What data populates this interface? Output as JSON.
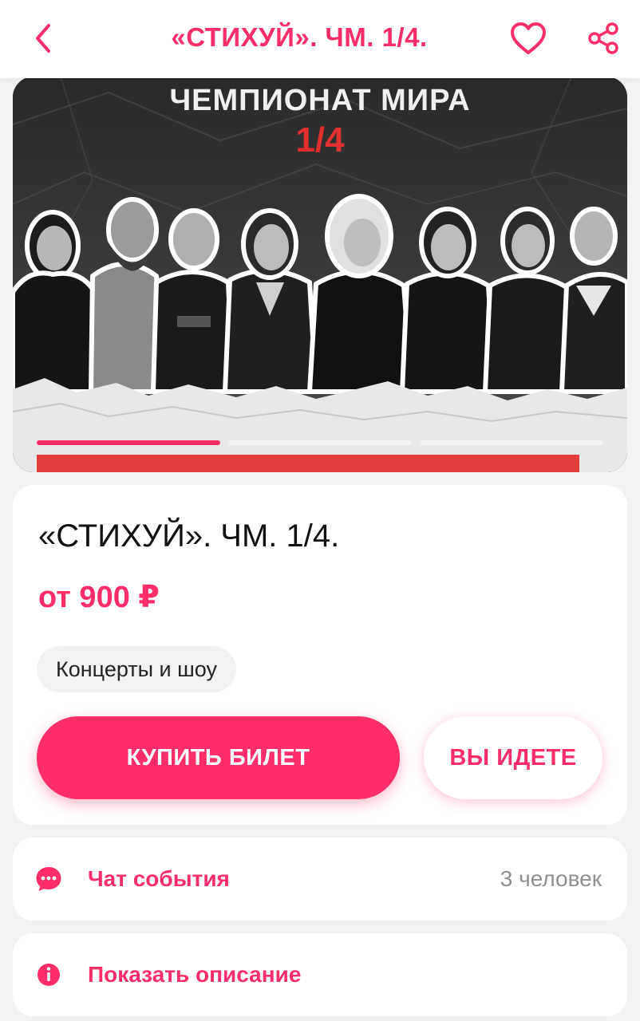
{
  "header": {
    "title": "«СТИХУЙ». ЧМ. 1/4.",
    "back_icon": "chevron-left-icon",
    "favorite_icon": "heart-icon",
    "share_icon": "share-icon"
  },
  "poster": {
    "headline": "ЧЕМПИОНАТ МИРА",
    "round": "1/4",
    "slides_total": 3,
    "slide_active": 1
  },
  "event": {
    "title": "«СТИХУЙ». ЧМ. 1/4.",
    "price": "от 900 ₽",
    "category": "Концерты и шоу",
    "buy_label": "КУПИТЬ БИЛЕТ",
    "going_label": "ВЫ ИДЕТЕ"
  },
  "chat": {
    "icon": "chat-bubble-icon",
    "label": "Чат события",
    "count": "3 человек"
  },
  "description": {
    "icon": "info-icon",
    "label": "Показать описание"
  },
  "colors": {
    "accent": "#ff2e6a",
    "background": "#f2f2f4",
    "card": "#ffffff",
    "muted": "#8e8e93"
  }
}
